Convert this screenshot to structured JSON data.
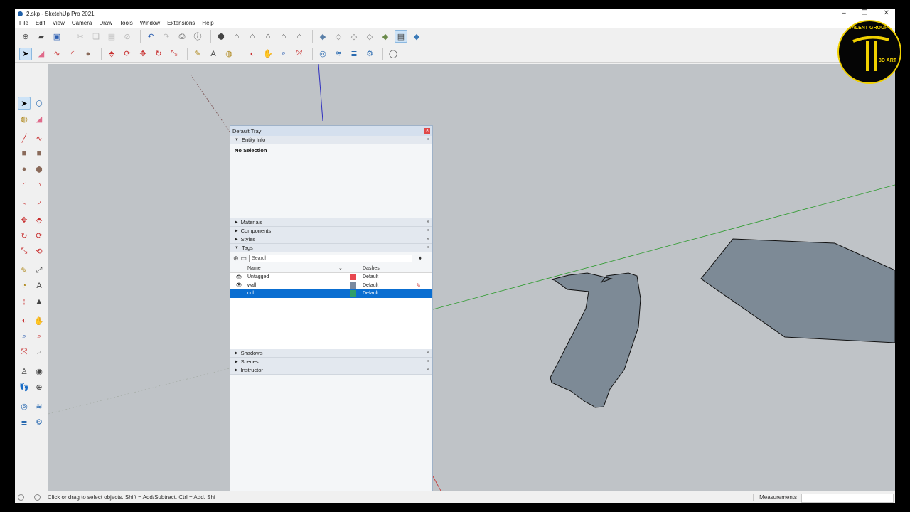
{
  "window": {
    "title": "2.skp - SketchUp Pro 2021",
    "controls": [
      "–",
      "❐",
      "✕"
    ]
  },
  "menu": [
    "File",
    "Edit",
    "View",
    "Camera",
    "Draw",
    "Tools",
    "Window",
    "Extensions",
    "Help"
  ],
  "tray": {
    "title": "Default Tray",
    "entity_info": {
      "label": "Entity Info",
      "selection": "No Selection"
    },
    "sections_top": [
      "Materials",
      "Components",
      "Styles"
    ],
    "tags": {
      "label": "Tags",
      "search_placeholder": "Search",
      "col_name": "Name",
      "col_dashes": "Dashes",
      "rows": [
        {
          "name": "Untagged",
          "color": "#e8474f",
          "dashes": "Default",
          "selected": false
        },
        {
          "name": "wall",
          "color": "#7a8aa0",
          "dashes": "Default",
          "selected": false
        },
        {
          "name": "col",
          "color": "#2e9e6a",
          "dashes": "Default",
          "selected": true
        }
      ]
    },
    "sections_bottom": [
      "Shadows",
      "Scenes",
      "Instructor"
    ]
  },
  "status": {
    "hint": "Click or drag to select objects. Shift = Add/Subtract. Ctrl = Add. Shi",
    "measurements_label": "Measurements",
    "measurements_value": ""
  },
  "logo": {
    "top_text": "TALENT GROUP",
    "side_text": "3D ART"
  },
  "colors": {
    "viewport": "#bfc3c7",
    "face": "#7d8a96",
    "selection": "#0a6ed1"
  }
}
